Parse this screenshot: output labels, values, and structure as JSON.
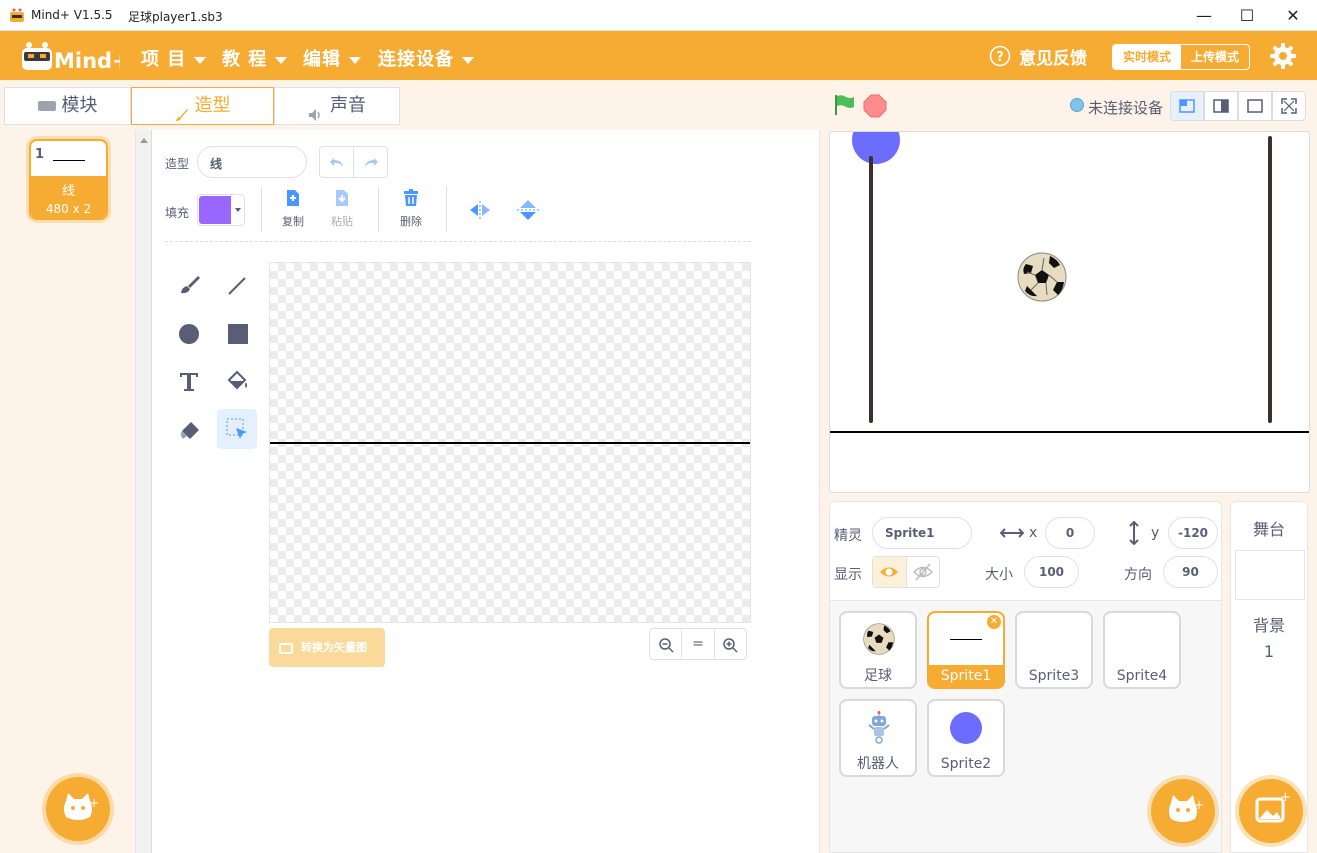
{
  "titlebar": {
    "app": "Mind+ V1.5.5",
    "file": "足球player1.sb3",
    "minimize": "—",
    "maximize": "☐",
    "close": "✕"
  },
  "menu": {
    "items": [
      {
        "label": "项 目"
      },
      {
        "label": "教 程"
      },
      {
        "label": "编辑"
      },
      {
        "label": "连接设备"
      }
    ],
    "feedback": "意见反馈",
    "mode_realtime": "实时模式",
    "mode_upload": "上传模式"
  },
  "tabs": {
    "blocks": "模块",
    "costumes": "造型",
    "sounds": "声音"
  },
  "costume_list": [
    {
      "index": "1",
      "name": "线",
      "size": "480 x 2"
    }
  ],
  "editor": {
    "costume_label": "造型",
    "costume_name": "线",
    "fill_label": "填充",
    "fill_color": "#9966ff",
    "copy": "复制",
    "paste": "粘贴",
    "delete": "删除",
    "convert": "转换为矢量图",
    "zoom_reset": "="
  },
  "stage": {
    "connection": "未连接设备"
  },
  "sprite_info": {
    "sprite_label": "精灵",
    "sprite_name": "Sprite1",
    "x_label": "x",
    "x": "0",
    "y_label": "y",
    "y": "-120",
    "show_label": "显示",
    "size_label": "大小",
    "size": "100",
    "direction_label": "方向",
    "direction": "90"
  },
  "sprites": [
    {
      "name": "足球"
    },
    {
      "name": "Sprite1"
    },
    {
      "name": "Sprite3"
    },
    {
      "name": "Sprite4"
    },
    {
      "name": "机器人"
    },
    {
      "name": "Sprite2"
    }
  ],
  "stage_panel": {
    "title": "舞台",
    "backdrop_label": "背景",
    "backdrop_count": "1"
  },
  "colors": {
    "accent": "#f6ac32",
    "selected_blue": "#4c97ff"
  }
}
